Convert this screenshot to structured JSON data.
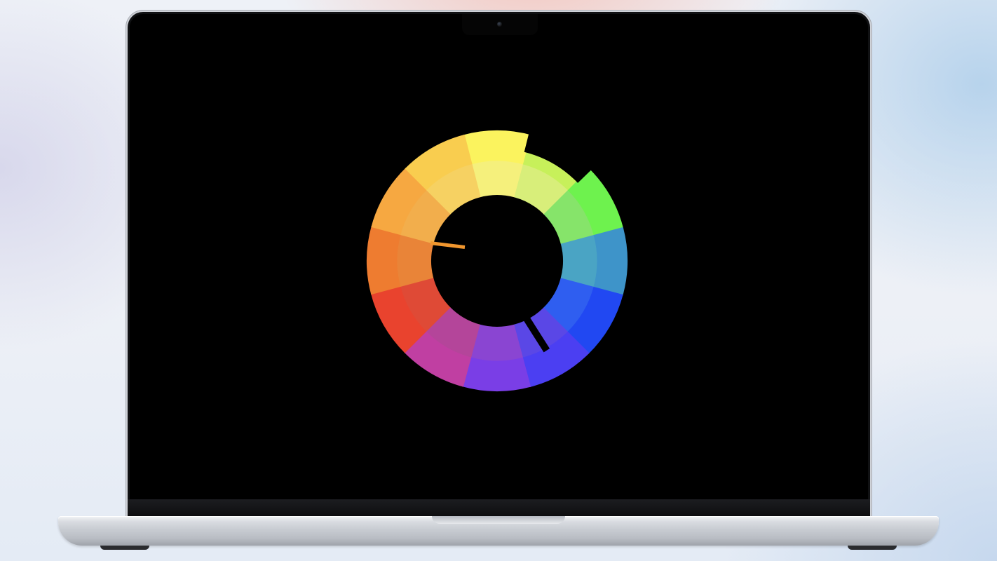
{
  "device": "laptop",
  "screen": {
    "background": "#000000"
  },
  "color_wheel": {
    "segments": [
      {
        "color": "#fbf35e",
        "inner_color": "#f5f07c",
        "angle": 0
      },
      {
        "color": "#c7f05a",
        "inner_color": "#d8ee7a",
        "angle": 30
      },
      {
        "color": "#6ef24e",
        "inner_color": "#86e46a",
        "angle": 60
      },
      {
        "color": "#3e94c9",
        "inner_color": "#4aa4c4",
        "angle": 90
      },
      {
        "color": "#2148f2",
        "inner_color": "#2f5ef0",
        "angle": 120
      },
      {
        "color": "#4b3ff2",
        "inner_color": "#5a47e6",
        "angle": 150
      },
      {
        "color": "#7a3ee6",
        "inner_color": "#8a45d2",
        "angle": 180
      },
      {
        "color": "#c03fa2",
        "inner_color": "#b4459a",
        "angle": 210
      },
      {
        "color": "#e9432e",
        "inner_color": "#df4a36",
        "angle": 240
      },
      {
        "color": "#ee7c30",
        "inner_color": "#e98438",
        "angle": 270
      },
      {
        "color": "#f6a841",
        "inner_color": "#f2ae4c",
        "angle": 300
      },
      {
        "color": "#f9cd4f",
        "inner_color": "#f6d162",
        "angle": 330
      }
    ],
    "notch_angles": [
      15,
      45
    ],
    "pointer_color": "#f0962e",
    "pointer_angle": 285,
    "second_hand_angle": 153
  }
}
